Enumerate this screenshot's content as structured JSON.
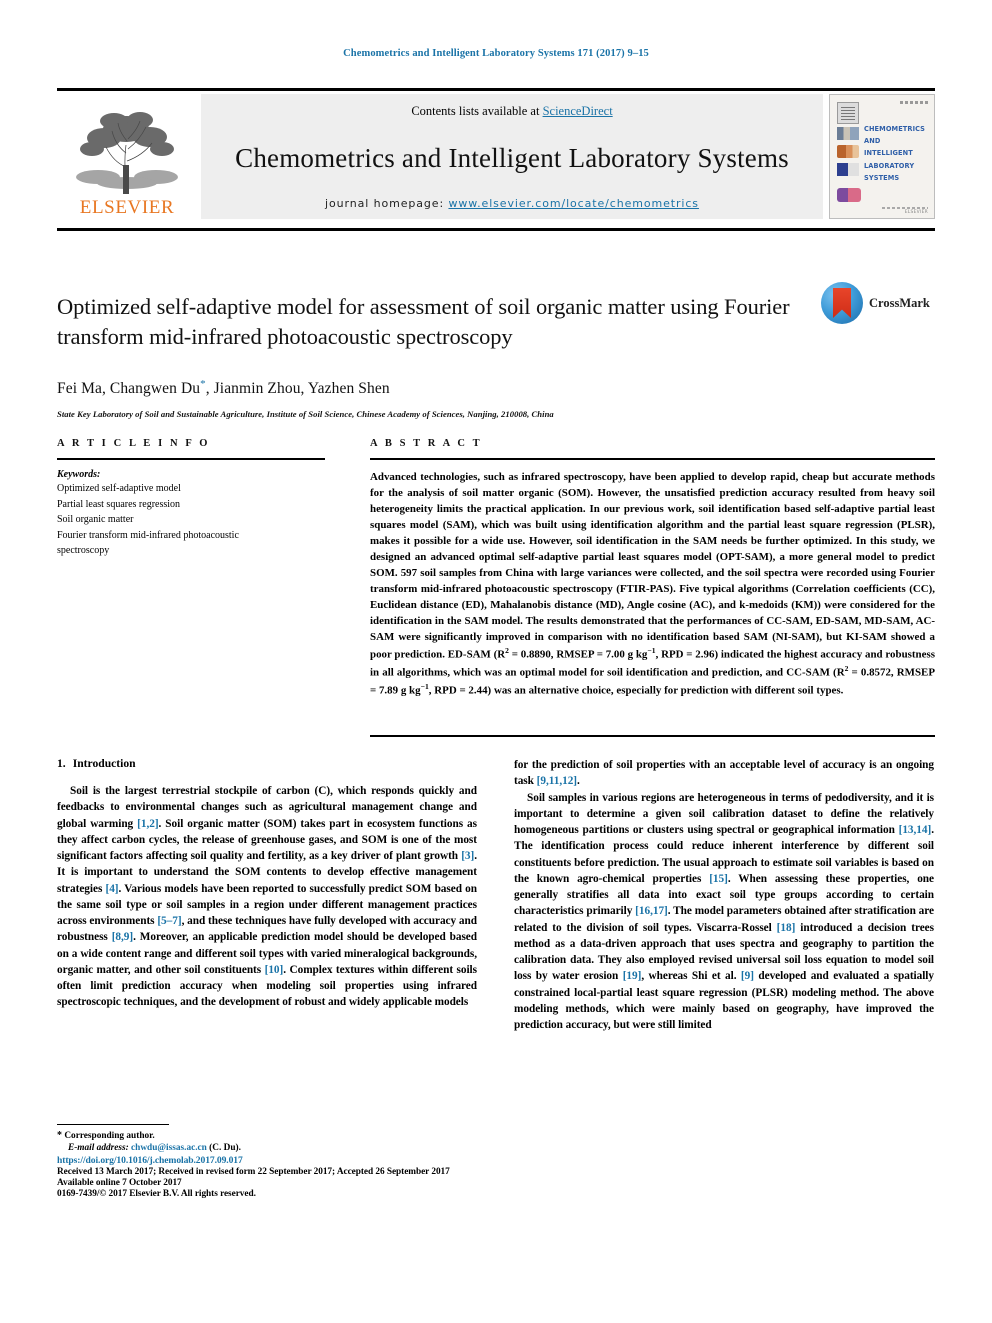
{
  "running_head": "Chemometrics and Intelligent Laboratory Systems 171 (2017) 9–15",
  "masthead": {
    "publisher": "ELSEVIER",
    "contents_prefix": "Contents lists available at ",
    "contents_link": "ScienceDirect",
    "journal_title": "Chemometrics and Intelligent Laboratory Systems",
    "homepage_prefix": "journal homepage: ",
    "homepage_url": "www.elsevier.com/locate/chemometrics",
    "cover_lines": [
      "CHEMOMETRICS",
      "AND INTELLIGENT",
      "LABORATORY",
      "SYSTEMS"
    ],
    "cover_publisher": "ELSEVIER",
    "accent_link_color": "#1a73a7",
    "brand_orange": "#E87722"
  },
  "article": {
    "title_line1": "Optimized self-adaptive model for assessment of soil organic matter using",
    "title_line2": "Fourier transform mid-infrared photoacoustic spectroscopy",
    "crossmark_label": "CrossMark",
    "authors": "Fei Ma, Changwen Du",
    "authors_rest": ", Jianmin Zhou, Yazhen Shen",
    "corresponding_marker": "*",
    "affiliation": "State Key Laboratory of Soil and Sustainable Agriculture, Institute of Soil Science, Chinese Academy of Sciences, Nanjing, 210008, China"
  },
  "article_info": {
    "heading": "A R T I C L E   I N F O",
    "keywords_label": "Keywords:",
    "keywords": [
      "Optimized self-adaptive model",
      "Partial least squares regression",
      "Soil organic matter",
      "Fourier transform mid-infrared photoacoustic",
      "spectroscopy"
    ]
  },
  "abstract": {
    "heading": "A B S T R A C T",
    "text": "Advanced technologies, such as infrared spectroscopy, have been applied to develop rapid, cheap but accurate methods for the analysis of soil matter organic (SOM). However, the unsatisfied prediction accuracy resulted from heavy soil heterogeneity limits the practical application. In our previous work, soil identification based self-adaptive partial least squares model (SAM), which was built using identification algorithm and the partial least square regression (PLSR), makes it possible for a wide use. However, soil identification in the SAM needs be further optimized. In this study, we designed an advanced optimal self-adaptive partial least squares model (OPT-SAM), a more general model to predict SOM. 597 soil samples from China with large variances were collected, and the soil spectra were recorded using Fourier transform mid-infrared photoacoustic spectroscopy (FTIR-PAS). Five typical algorithms (Correlation coefficients (CC), Euclidean distance (ED), Mahalanobis distance (MD), Angle cosine (AC), and k-medoids (KM)) were considered for the identification in the SAM model. The results demonstrated that the performances of CC-SAM, ED-SAM, MD-SAM, AC-SAM were significantly improved in comparison with no identification based SAM (NI-SAM), but KI-SAM showed a poor prediction. ED-SAM (R2 = 0.8890, RMSEP = 7.00 g kg−1, RPD = 2.96) indicated the highest accuracy and robustness in all algorithms, which was an optimal model for soil identification and prediction, and CC-SAM (R2 = 0.8572, RMSEP = 7.89 g kg−1, RPD = 2.44) was an alternative choice, especially for prediction with different soil types."
  },
  "body": {
    "section_number": "1.",
    "section_title": "Introduction",
    "left_paragraphs": [
      "Soil is the largest terrestrial stockpile of carbon (C), which responds quickly and feedbacks to environmental changes such as agricultural management change and global warming [1,2]. Soil organic matter (SOM) takes part in ecosystem functions as they affect carbon cycles, the release of greenhouse gases, and SOM is one of the most significant factors affecting soil quality and fertility, as a key driver of plant growth [3]. It is important to understand the SOM contents to develop effective management strategies [4]. Various models have been reported to successfully predict SOM based on the same soil type or soil samples in a region under different management practices across environments [5–7], and these techniques have fully developed with accuracy and robustness [8,9]. Moreover, an applicable prediction model should be developed based on a wide content range and different soil types with varied mineralogical backgrounds, organic matter, and other soil constituents [10]. Complex textures within different soils often limit prediction accuracy when modeling soil properties using infrared spectroscopic techniques, and the development of robust and widely applicable models"
    ],
    "right_paragraphs": [
      "for the prediction of soil properties with an acceptable level of accuracy is an ongoing task [9,11,12].",
      "Soil samples in various regions are heterogeneous in terms of pedodiversity, and it is important to determine a given soil calibration dataset to define the relatively homogeneous partitions or clusters using spectral or geographical information [13,14]. The identification process could reduce inherent interference by different soil constituents before prediction. The usual approach to estimate soil variables is based on the known agro-chemical properties [15]. When assessing these properties, one generally stratifies all data into exact soil type groups according to certain characteristics primarily [16,17]. The model parameters obtained after stratification are related to the division of soil types. Viscarra-Rossel [18] introduced a decision trees method as a data-driven approach that uses spectra and geography to partition the calibration data. They also employed revised universal soil loss equation to model soil loss by water erosion [19], whereas Shi et al. [9] developed and evaluated a spatially constrained local-partial least square regression (PLSR) modeling method. The above modeling methods, which were mainly based on geography, have improved the prediction accuracy, but were still limited"
    ]
  },
  "footnote": {
    "corresponding": "Corresponding author.",
    "email_label": "E-mail address:",
    "email": "chwdu@issas.ac.cn",
    "email_suffix": "(C. Du)."
  },
  "footer": {
    "doi": "https://doi.org/10.1016/j.chemolab.2017.09.017",
    "received": "Received 13 March 2017; Received in revised form 22 September 2017; Accepted 26 September 2017",
    "available": "Available online 7 October 2017",
    "copyright": "0169-7439/© 2017 Elsevier B.V. All rights reserved."
  }
}
